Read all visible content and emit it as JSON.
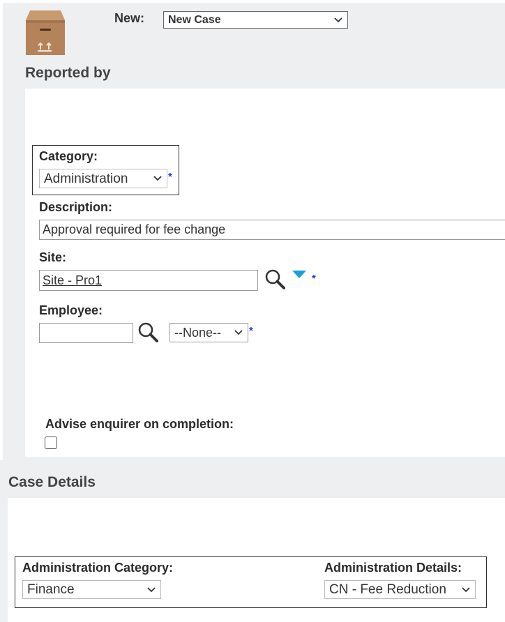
{
  "header": {
    "new_label": "New:",
    "new_select_value": "New Case",
    "icon": "box-icon"
  },
  "reported_by": {
    "title": "Reported by",
    "category": {
      "label": "Category:",
      "value": "Administration",
      "required": "*"
    },
    "description": {
      "label": "Description:",
      "value": "Approval required for fee change"
    },
    "site": {
      "label": "Site:",
      "value": "Site - Pro1",
      "required": "*"
    },
    "employee": {
      "label": "Employee:",
      "value": "",
      "type_value": "--None--",
      "required": "*"
    },
    "advise": {
      "label": "Advise enquirer on completion:",
      "checked": false
    }
  },
  "case_details": {
    "title": "Case Details",
    "admin_category": {
      "label": "Administration Category:",
      "value": "Finance"
    },
    "admin_details": {
      "label": "Administration Details:",
      "value": "CN - Fee Reduction"
    }
  },
  "colors": {
    "accent_triangle": "#1aa0d8",
    "required_star": "#1a3fc7",
    "box": "#b5835a"
  }
}
